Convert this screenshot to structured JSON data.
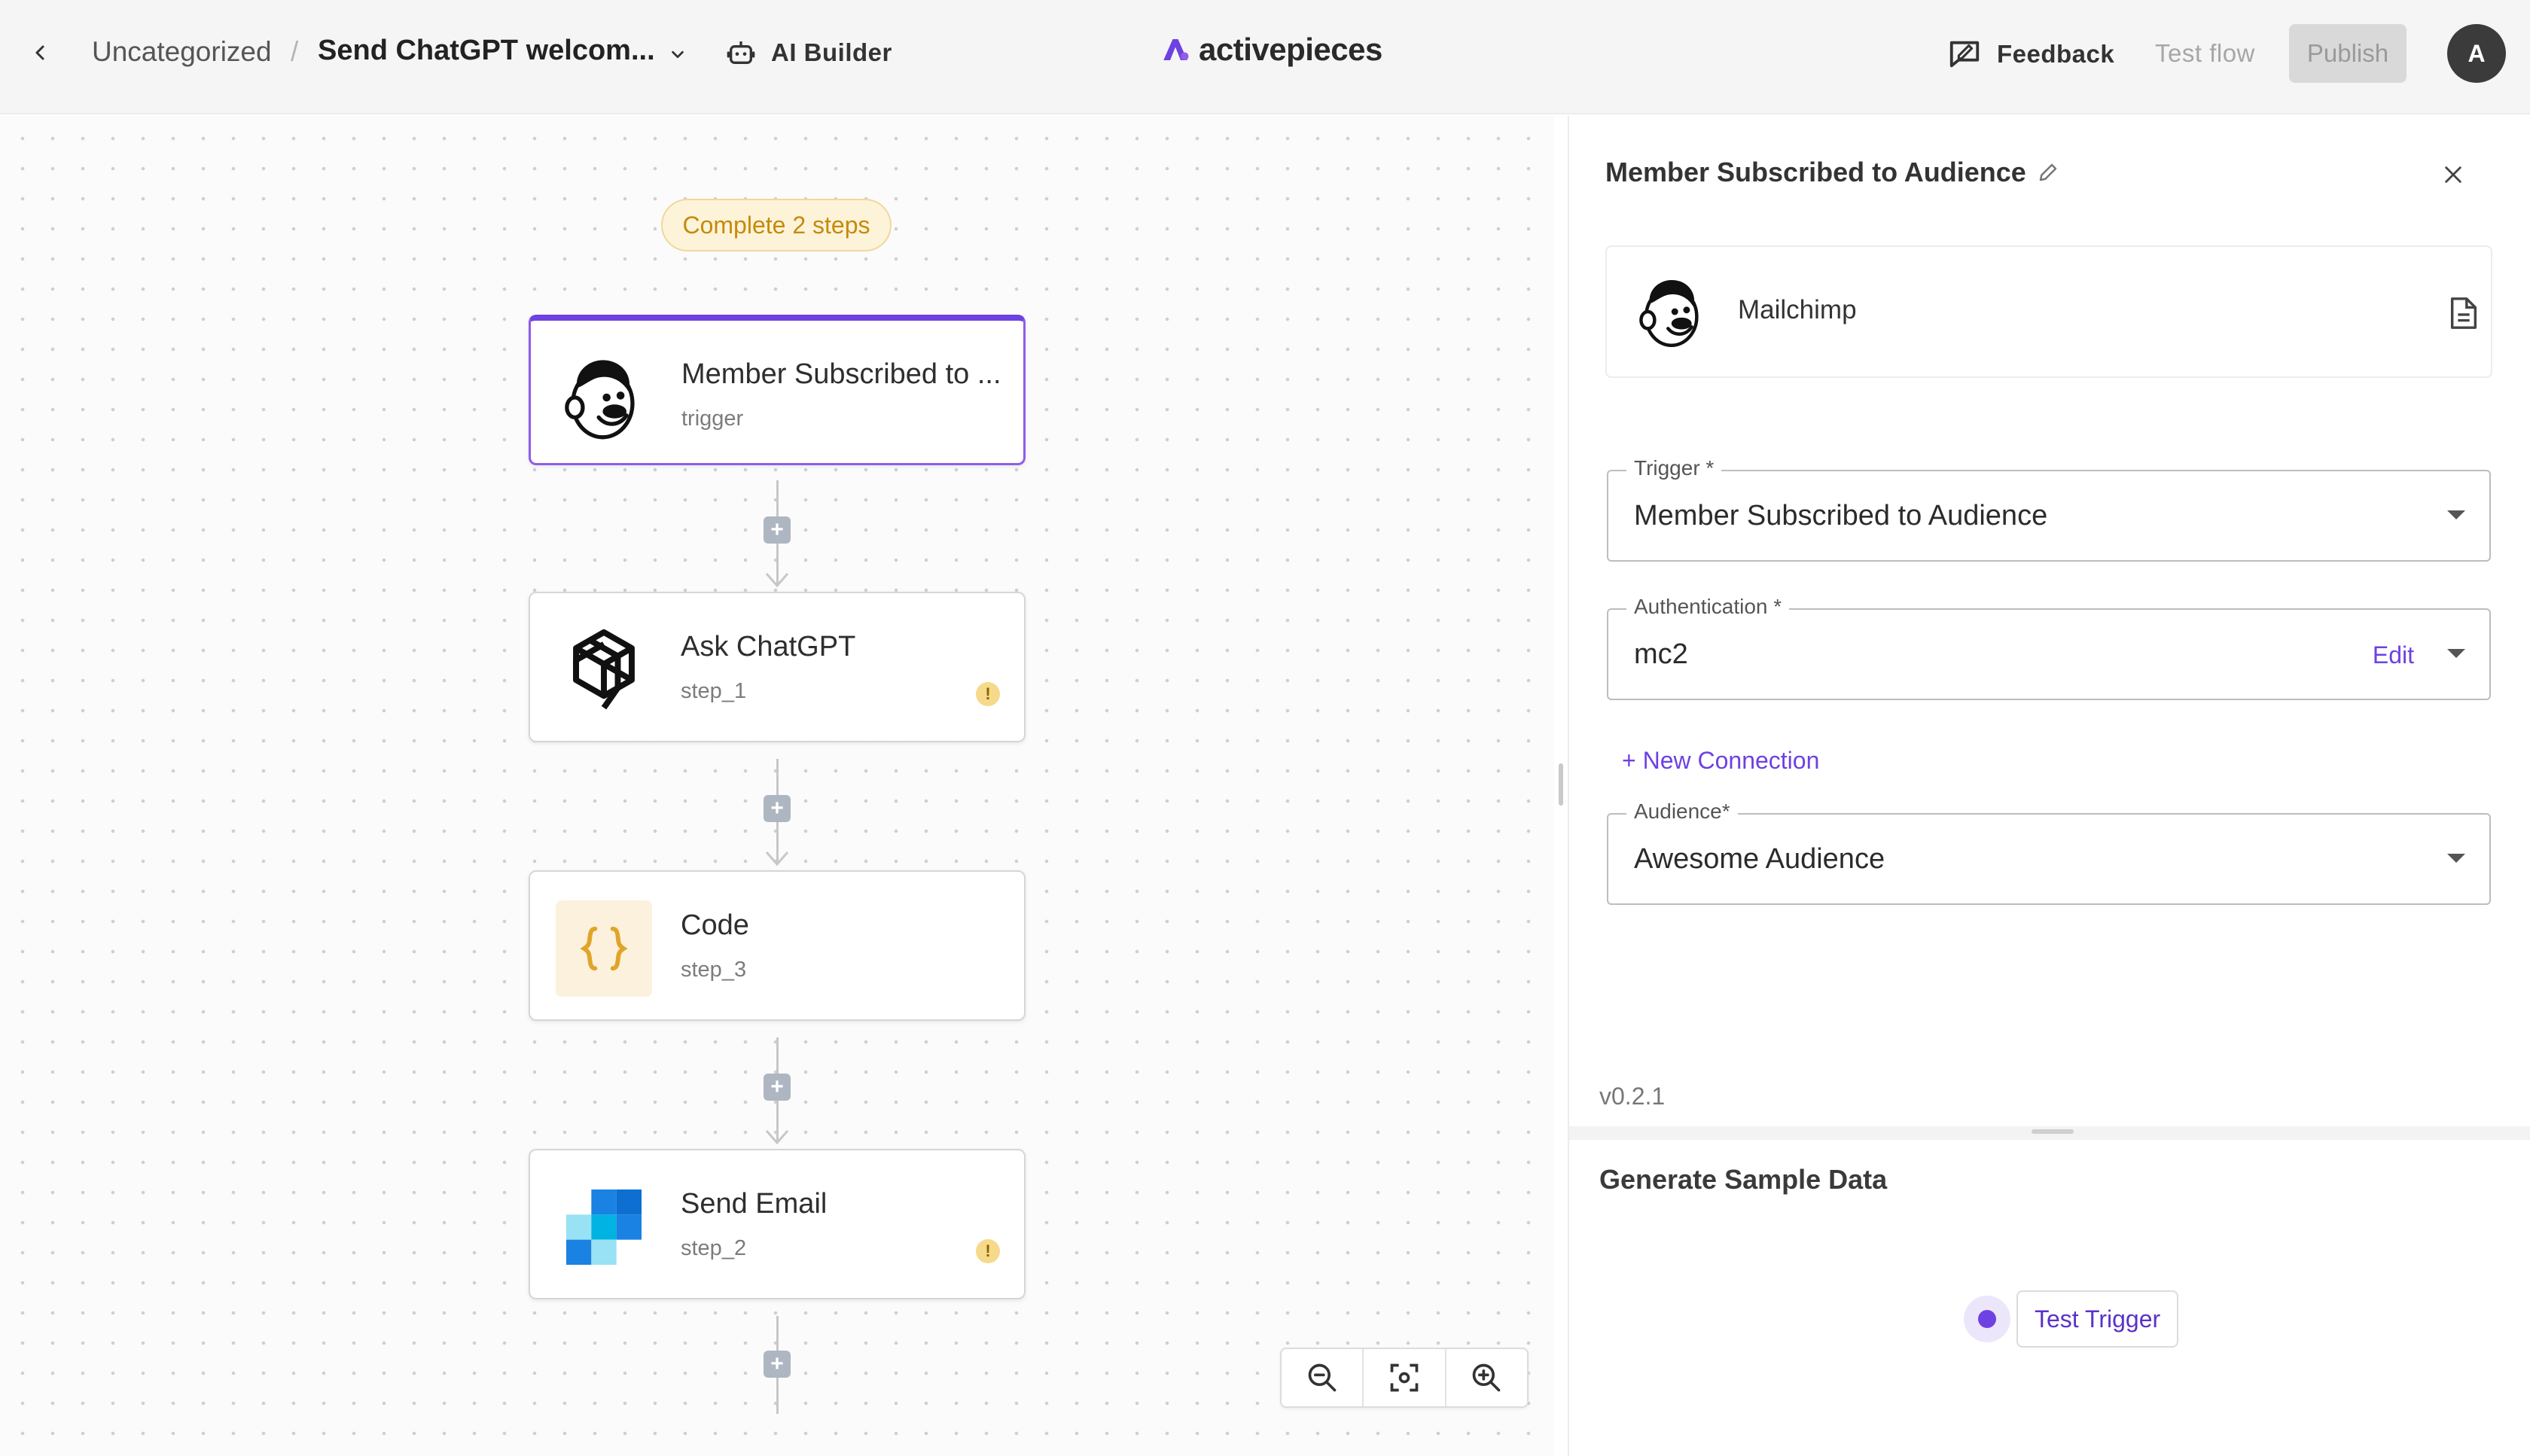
{
  "topbar": {
    "folder": "Uncategorized",
    "separator": "/",
    "flow_name": "Send ChatGPT welcom...",
    "ai_builder": "AI Builder",
    "brand": "activepieces",
    "feedback": "Feedback",
    "test_flow": "Test flow",
    "publish": "Publish",
    "avatar_initial": "A"
  },
  "canvas": {
    "status_pill": "Complete 2 steps",
    "steps": [
      {
        "name": "Member Subscribed to ...",
        "sub": "trigger",
        "icon": "mailchimp-icon",
        "warning": false,
        "selected": true
      },
      {
        "name": "Ask ChatGPT",
        "sub": "step_1",
        "icon": "openai-icon",
        "warning": true
      },
      {
        "name": "Code",
        "sub": "step_3",
        "icon": "code-icon",
        "warning": false
      },
      {
        "name": "Send Email",
        "sub": "step_2",
        "icon": "sendgrid-icon",
        "warning": true
      }
    ],
    "warning_glyph": "!",
    "plus_glyph": "+",
    "zoom_controls": [
      "zoom-out-icon",
      "fit-view-icon",
      "zoom-in-icon"
    ]
  },
  "panel": {
    "title": "Member Subscribed to Audience",
    "piece_name": "Mailchimp",
    "trigger_label": "Trigger *",
    "trigger_value": "Member Subscribed to Audience",
    "auth_label": "Authentication *",
    "auth_value": "mc2",
    "auth_edit": "Edit",
    "new_connection": "+ New Connection",
    "audience_label": "Audience*",
    "audience_value": "Awesome Audience",
    "version": "v0.2.1",
    "sample_title": "Generate Sample Data",
    "test_trigger": "Test Trigger"
  },
  "colors": {
    "accent": "#6e41e2",
    "warning": "#f6d98a",
    "pill_bg": "#fdf3d9",
    "pill_text": "#c68a0b"
  }
}
